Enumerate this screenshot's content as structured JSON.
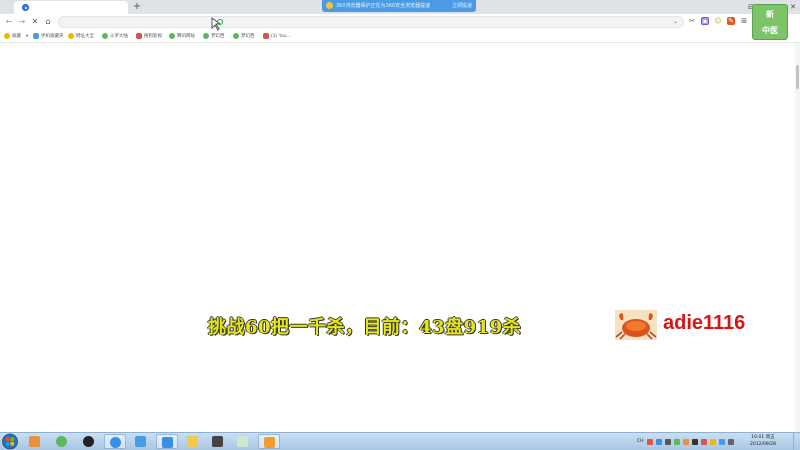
{
  "browser": {
    "tab_title": "",
    "new_tab_label": "+",
    "notice_text": "360浏览器保护正在为360安全浏览器提速",
    "notice_action": "立即提速",
    "window_controls": [
      "⊟",
      "—",
      "☐",
      "✕"
    ],
    "nav": {
      "back": "←",
      "forward": "→",
      "reload": "✕",
      "home": "⌂"
    },
    "address_value": "",
    "address_dropdown": "⌄",
    "extensions": [
      "✂",
      "▣",
      "☺",
      "✎",
      "⊞"
    ]
  },
  "bookmarks": {
    "items": [
      {
        "label": "收藏",
        "color": "#f2b705"
      },
      {
        "label": "▾",
        "color": ""
      },
      {
        "label": "手机收藏夹",
        "color": "#4a9be3"
      },
      {
        "label": "网址大全",
        "color": "#f2b705"
      },
      {
        "label": "斗罗大陆",
        "color": "#5cb85c"
      },
      {
        "label": "搜狗影视",
        "color": "#d9534f"
      },
      {
        "label": "腾讯网站",
        "color": "#5cb85c"
      },
      {
        "label": "梦幻西",
        "color": "#5cb85c"
      },
      {
        "label": "梦幻西",
        "color": "#5cb85c"
      },
      {
        "label": "(1) You...",
        "color": "#d9534f"
      }
    ]
  },
  "stream_overlay": {
    "challenge_text": "挑战60把一千杀，目前：43盘919杀",
    "username": "adie1116",
    "logo_line1": "新",
    "logo_line2": "中医"
  },
  "taskbar": {
    "apps": [
      {
        "name": "app",
        "color": "#e8903a"
      },
      {
        "name": "app",
        "color": "#5cb85c"
      },
      {
        "name": "app",
        "color": "#222222"
      },
      {
        "name": "app",
        "color": "#3a8ee6"
      },
      {
        "name": "app",
        "color": "#4a9be3"
      },
      {
        "name": "app",
        "color": "#f2c94c"
      },
      {
        "name": "app",
        "color": "#444444"
      },
      {
        "name": "app",
        "color": "#cfe6cf"
      },
      {
        "name": "app",
        "color": "#f29b2e"
      }
    ],
    "tray_lang": "CH",
    "clock_time": "16:01 周五",
    "clock_date": "2012/09/28"
  }
}
